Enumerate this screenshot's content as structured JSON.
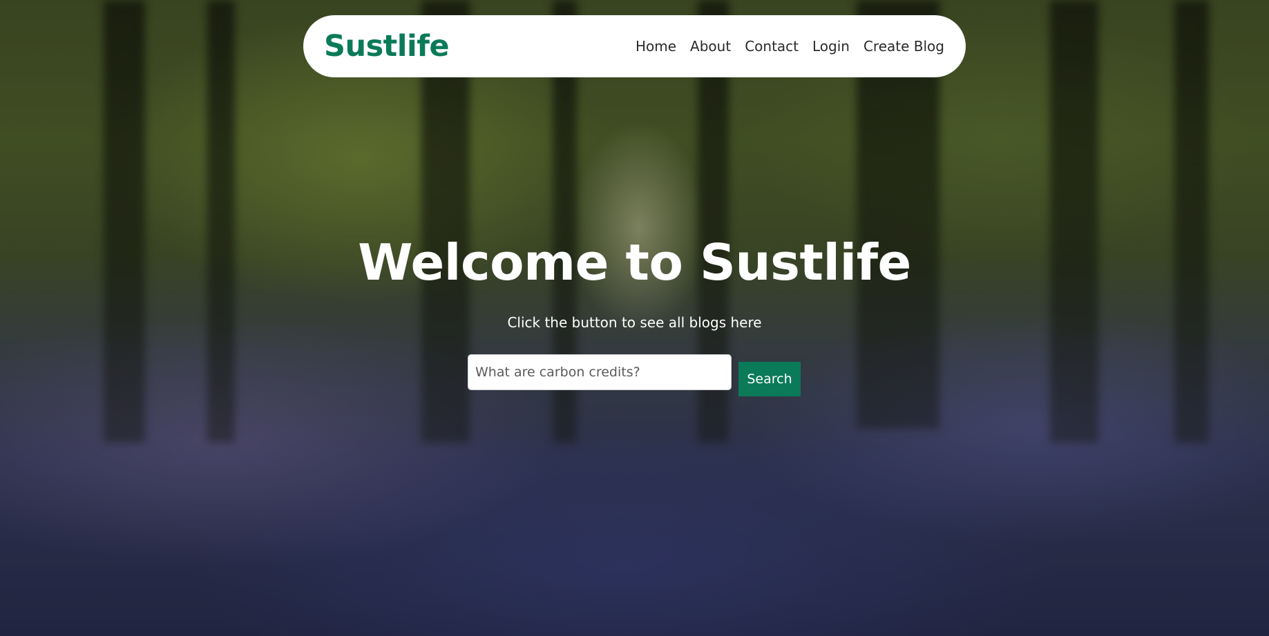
{
  "brand": "Sustlife",
  "nav": {
    "links": [
      "Home",
      "About",
      "Contact",
      "Login",
      "Create Blog"
    ]
  },
  "hero": {
    "title": "Welcome to Sustlife",
    "subtitle": "Click the button to see all blogs here",
    "search_placeholder": "What are carbon credits?",
    "search_button": "Search"
  },
  "colors": {
    "brand": "#0b7a58",
    "navbar_bg": "#ffffff",
    "hero_text": "#ffffff"
  }
}
